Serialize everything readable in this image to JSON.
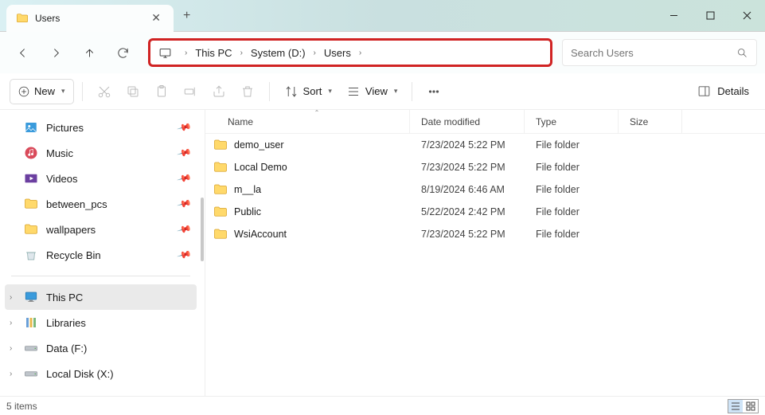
{
  "tab": {
    "title": "Users"
  },
  "breadcrumb": {
    "items": [
      "This PC",
      "System (D:)",
      "Users"
    ]
  },
  "search": {
    "placeholder": "Search Users"
  },
  "toolbar": {
    "new_label": "New",
    "sort_label": "Sort",
    "view_label": "View",
    "details_label": "Details"
  },
  "sidebar": {
    "quick": [
      {
        "label": "Pictures",
        "icon": "pictures",
        "pinned": true
      },
      {
        "label": "Music",
        "icon": "music",
        "pinned": true
      },
      {
        "label": "Videos",
        "icon": "videos",
        "pinned": true
      },
      {
        "label": "between_pcs",
        "icon": "folder",
        "pinned": true
      },
      {
        "label": "wallpapers",
        "icon": "folder",
        "pinned": true
      },
      {
        "label": "Recycle Bin",
        "icon": "recycle",
        "pinned": true
      }
    ],
    "nav": [
      {
        "label": "This PC",
        "icon": "pc",
        "expandable": true,
        "selected": true
      },
      {
        "label": "Libraries",
        "icon": "libraries",
        "expandable": true
      },
      {
        "label": "Data (F:)",
        "icon": "drive",
        "expandable": true
      },
      {
        "label": "Local Disk (X:)",
        "icon": "drive",
        "expandable": true
      }
    ]
  },
  "columns": {
    "name": "Name",
    "date": "Date modified",
    "type": "Type",
    "size": "Size"
  },
  "rows": [
    {
      "name": "demo_user",
      "date": "7/23/2024 5:22 PM",
      "type": "File folder"
    },
    {
      "name": "Local Demo",
      "date": "7/23/2024 5:22 PM",
      "type": "File folder"
    },
    {
      "name": "m__la",
      "date": "8/19/2024 6:46 AM",
      "type": "File folder"
    },
    {
      "name": "Public",
      "date": "5/22/2024 2:42 PM",
      "type": "File folder"
    },
    {
      "name": "WsiAccount",
      "date": "7/23/2024 5:22 PM",
      "type": "File folder"
    }
  ],
  "status": {
    "count": "5 items"
  }
}
